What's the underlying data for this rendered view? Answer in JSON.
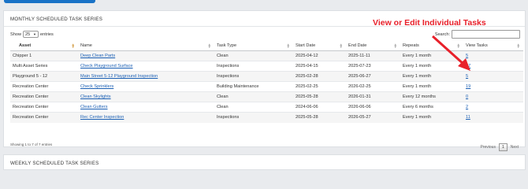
{
  "monthly": {
    "title": "MONTHLY SCHEDULED TASK SERIES",
    "show_label": "Show",
    "show_value": "25",
    "entries_label": "entries",
    "search_label": "Search:",
    "search_value": "",
    "columns": [
      "Asset",
      "Name",
      "Task Type",
      "Start Date",
      "End Date",
      "Repeats",
      "View Tasks"
    ],
    "rows": [
      {
        "asset": "Chipper 1",
        "name": "Deep Clean Parts",
        "type": "Clean",
        "start": "2025-04-12",
        "end": "2025-11-11",
        "repeats": "Every 1 month",
        "view": "5"
      },
      {
        "asset": "Multi Asset Series",
        "name": "Check Playground Surface",
        "type": "Inspections",
        "start": "2025-04-15",
        "end": "2025-07-23",
        "repeats": "Every 1 month",
        "view": "27"
      },
      {
        "asset": "Playground 5 - 12",
        "name": "Main Street 5-12 Playground Inspection",
        "type": "Inspections",
        "start": "2025-02-28",
        "end": "2025-06-27",
        "repeats": "Every 1 month",
        "view": "5"
      },
      {
        "asset": "Recreation Center",
        "name": "Check Sprinklers",
        "type": "Building Maintenance",
        "start": "2025-02-25",
        "end": "2026-02-25",
        "repeats": "Every 1 month",
        "view": "19"
      },
      {
        "asset": "Recreation Center",
        "name": "Clean Skylights",
        "type": "Clean",
        "start": "2025-05-28",
        "end": "2026-01-31",
        "repeats": "Every 12 months",
        "view": "0"
      },
      {
        "asset": "Recreation Center",
        "name": "Clean Gutters",
        "type": "Clean",
        "start": "2024-06-06",
        "end": "2026-06-06",
        "repeats": "Every 6 months",
        "view": "2"
      },
      {
        "asset": "Recreation Center",
        "name": "Rec Center Inspection",
        "type": "Inspections",
        "start": "2025-05-28",
        "end": "2026-05-27",
        "repeats": "Every 1 month",
        "view": "11"
      }
    ],
    "info": "Showing 1 to 7 of 7 entries",
    "pager": {
      "previous": "Previous",
      "current": "1",
      "next": "Next"
    }
  },
  "annotation": "View or Edit Individual Tasks",
  "annotation_color": "#e8202a",
  "weekly": {
    "title": "WEEKLY SCHEDULED TASK SERIES"
  }
}
